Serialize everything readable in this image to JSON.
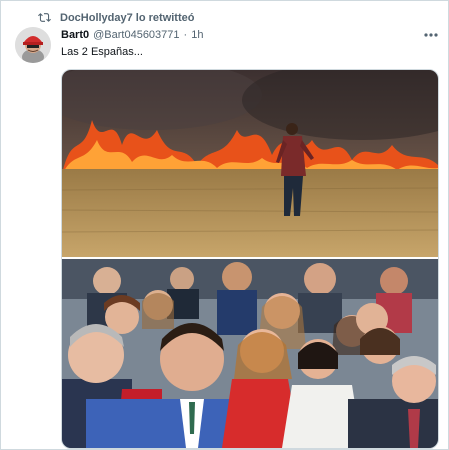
{
  "retweet": {
    "icon": "retweet-icon",
    "text": "DocHollyday7 lo retwitteó"
  },
  "tweet": {
    "display_name": "Bart0",
    "handle": "@Bart045603771",
    "separator": "·",
    "time": "1h",
    "text": "Las 2 Españas...",
    "more_icon": "more-dots-icon"
  },
  "media": {
    "photos": [
      {
        "subject": "field-fire-photo"
      },
      {
        "subject": "group-selfie-photo"
      }
    ]
  },
  "colors": {
    "secondary_text": "#536471",
    "primary_text": "#0f1419",
    "border": "#cfd9de"
  }
}
